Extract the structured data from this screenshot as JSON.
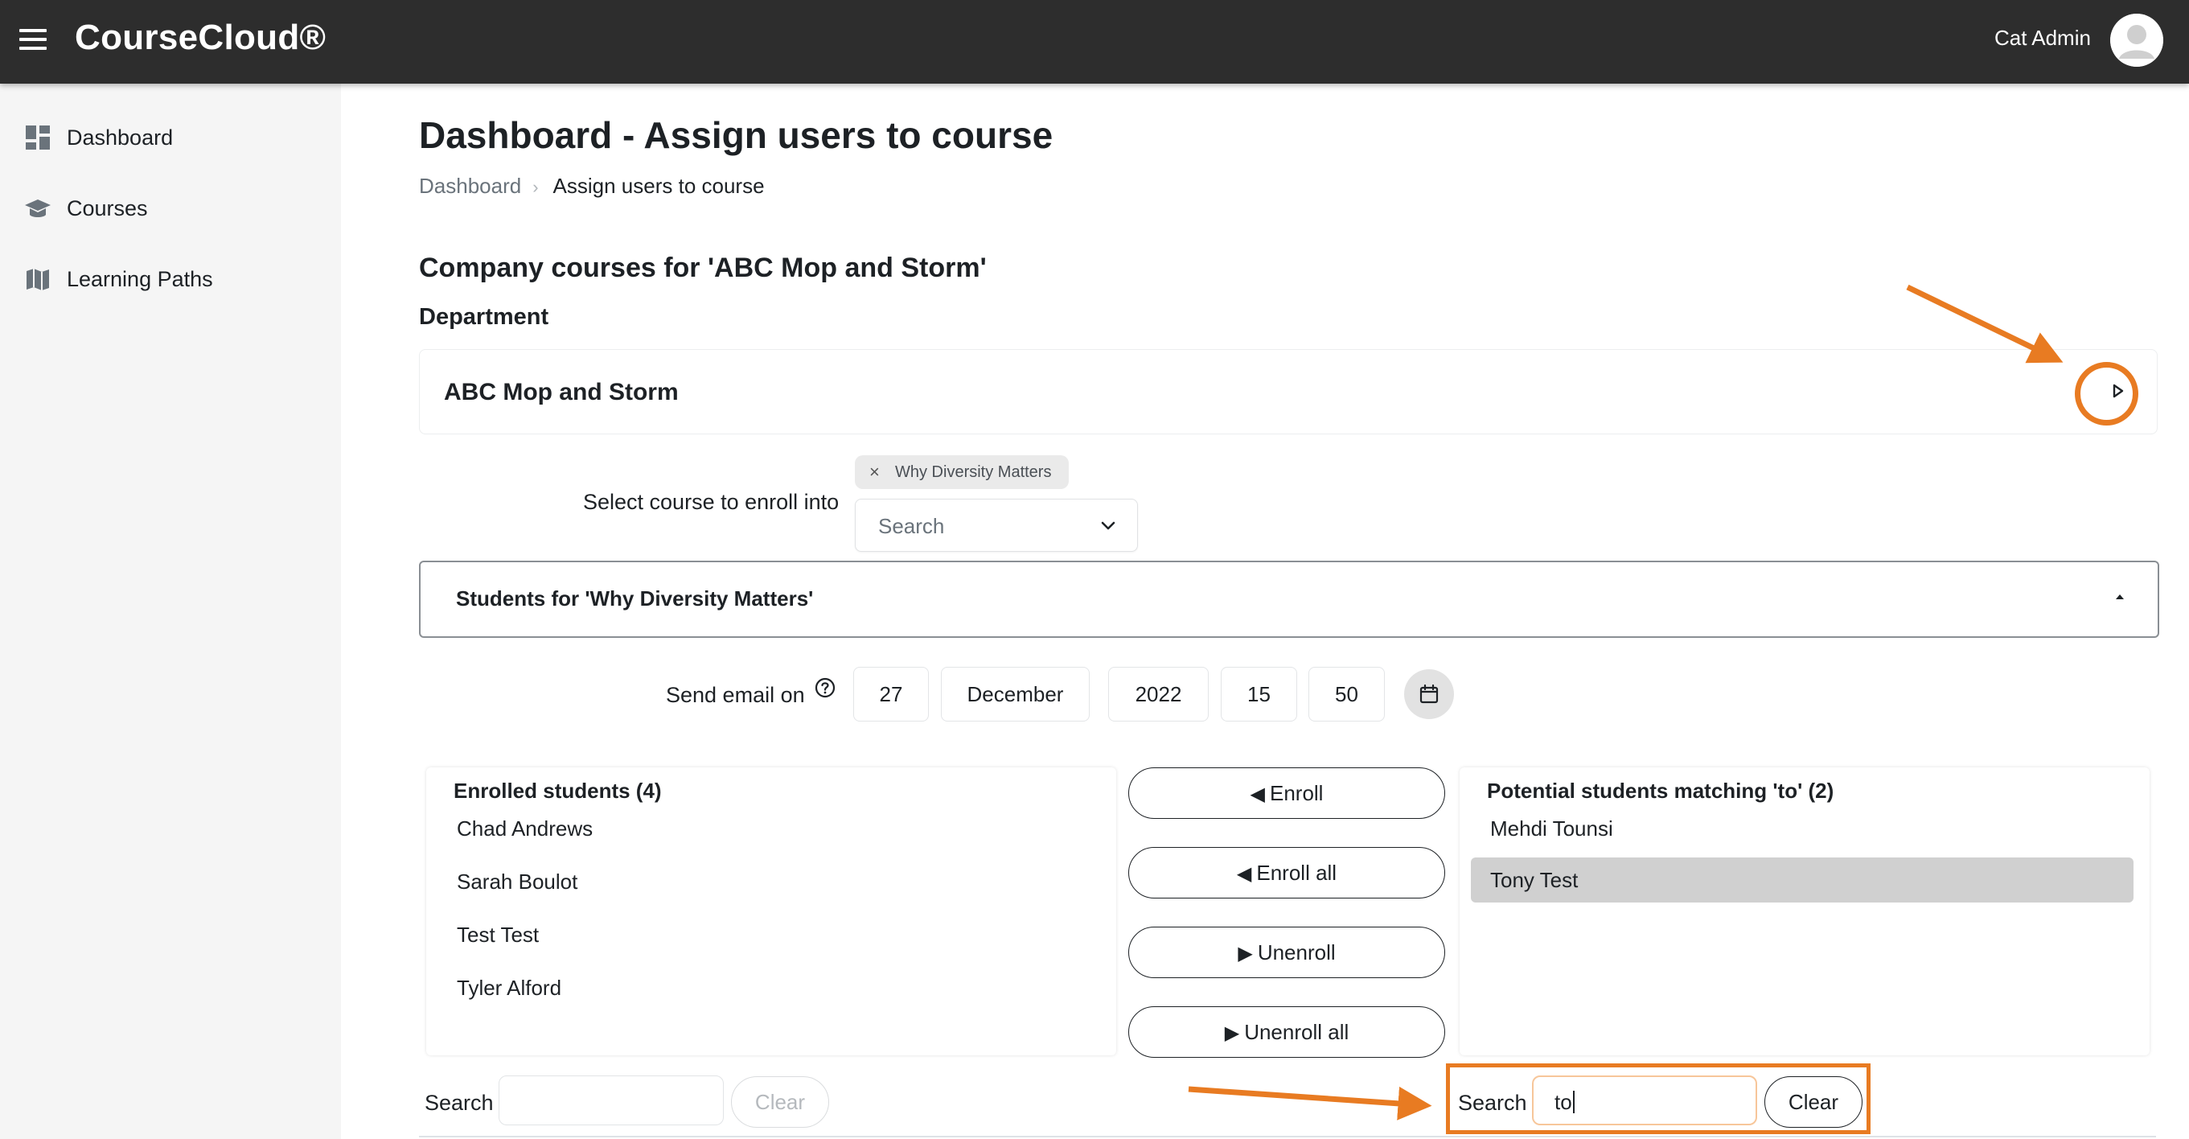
{
  "app": {
    "brand": "CourseCloud®",
    "user_name": "Cat Admin"
  },
  "sidebar": {
    "items": [
      {
        "label": "Dashboard",
        "icon": "dashboard-icon"
      },
      {
        "label": "Courses",
        "icon": "graduation-cap-icon"
      },
      {
        "label": "Learning Paths",
        "icon": "map-icon"
      }
    ]
  },
  "page": {
    "title": "Dashboard - Assign users to course",
    "breadcrumb": {
      "link": "Dashboard",
      "current": "Assign users to course"
    },
    "section_title": "Company courses for 'ABC Mop and Storm'",
    "department_label": "Department",
    "department_name": "ABC Mop and Storm"
  },
  "course_select": {
    "label": "Select course to enroll into",
    "selected_tag": "Why Diversity Matters",
    "placeholder": "Search"
  },
  "students_panel": {
    "title": "Students for 'Why Diversity Matters'"
  },
  "send_email": {
    "label": "Send email on",
    "day": "27",
    "month": "December",
    "year": "2022",
    "hour": "15",
    "minute": "50"
  },
  "enrolled": {
    "heading": "Enrolled students (4)",
    "items": [
      "Chad Andrews",
      "Sarah Boulot",
      "Test Test",
      "Tyler Alford"
    ],
    "search_label": "Search",
    "search_value": "",
    "clear_label": "Clear"
  },
  "actions": {
    "enroll": "Enroll",
    "enroll_all": "Enroll all",
    "unenroll": "Unenroll",
    "unenroll_all": "Unenroll all"
  },
  "potential": {
    "heading": "Potential students matching 'to' (2)",
    "items": [
      "Mehdi Tounsi",
      "Tony Test"
    ],
    "selected_item": "Tony Test",
    "search_label": "Search",
    "search_value": "to",
    "clear_label": "Clear"
  },
  "colors": {
    "topbar": "#2d2d2d",
    "sidebar": "#f5f5f5",
    "annotation": "#e87b22",
    "selected_row": "#d0d0d0"
  }
}
